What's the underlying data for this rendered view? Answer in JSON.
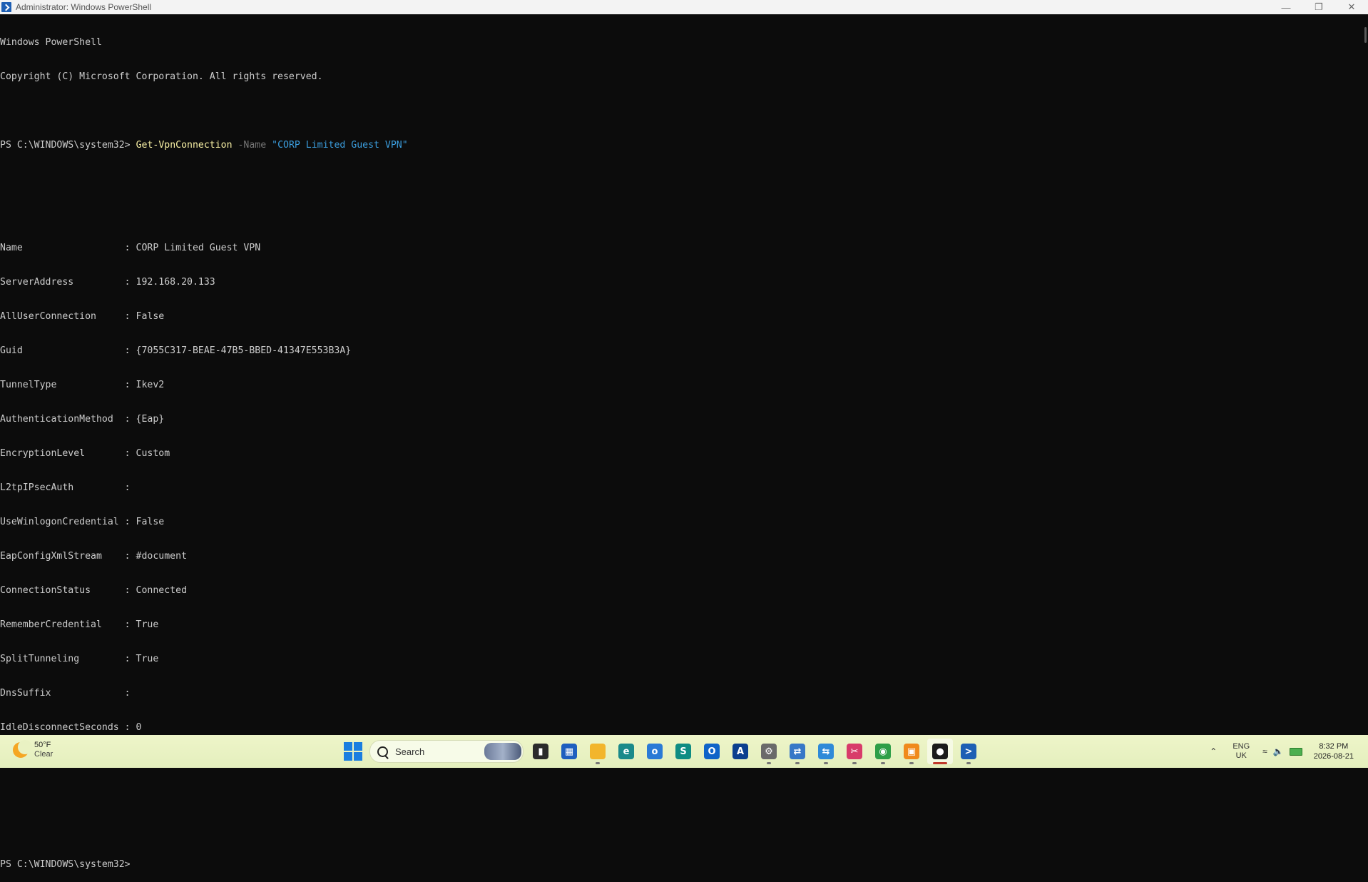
{
  "window": {
    "title": "Administrator: Windows PowerShell",
    "minimize_icon": "minimize-icon",
    "maximize_icon": "restore-icon",
    "close_icon": "close-icon"
  },
  "console": {
    "banner1": "Windows PowerShell",
    "banner2": "Copyright (C) Microsoft Corporation. All rights reserved.",
    "prompt": "PS C:\\WINDOWS\\system32> ",
    "command": "Get-VpnConnection",
    "param": " -Name ",
    "arg": "\"CORP Limited Guest VPN\"",
    "output": [
      "Name                  : CORP Limited Guest VPN",
      "ServerAddress         : 192.168.20.133",
      "AllUserConnection     : False",
      "Guid                  : {7055C317-BEAE-47B5-BBED-41347E553B3A}",
      "TunnelType            : Ikev2",
      "AuthenticationMethod  : {Eap}",
      "EncryptionLevel       : Custom",
      "L2tpIPsecAuth         :",
      "UseWinlogonCredential : False",
      "EapConfigXmlStream    : #document",
      "ConnectionStatus      : Connected",
      "RememberCredential    : True",
      "SplitTunneling        : True",
      "DnsSuffix             :",
      "IdleDisconnectSeconds : 0"
    ],
    "final_prompt": "PS C:\\WINDOWS\\system32>"
  },
  "taskbar": {
    "weather": {
      "temp": "50°F",
      "condition": "Clear",
      "icon": "moon-icon"
    },
    "search": {
      "label": "Search"
    },
    "apps": [
      {
        "name": "task-view",
        "icon": "task-view-icon",
        "color": "#2b2b2b",
        "glyph": "▮",
        "running": false
      },
      {
        "name": "microsoft-store",
        "icon": "store-icon",
        "color": "#1f5fbf",
        "glyph": "▦",
        "running": false
      },
      {
        "name": "file-explorer",
        "icon": "folder-icon",
        "color": "#f2b52c",
        "glyph": "",
        "running": true
      },
      {
        "name": "edge",
        "icon": "edge-icon",
        "color": "#1b8a8a",
        "glyph": "e",
        "running": false
      },
      {
        "name": "outlook-new",
        "icon": "outlook-new-icon",
        "color": "#2a7ad6",
        "glyph": "o",
        "running": false
      },
      {
        "name": "sharepoint",
        "icon": "sharepoint-icon",
        "color": "#0e8c83",
        "glyph": "S",
        "running": false
      },
      {
        "name": "outlook",
        "icon": "outlook-icon",
        "color": "#0f64c8",
        "glyph": "O",
        "running": false
      },
      {
        "name": "azure-data-studio",
        "icon": "a-icon",
        "color": "#0b3f8f",
        "glyph": "A",
        "running": false
      },
      {
        "name": "settings",
        "icon": "gear-icon",
        "color": "#6a6a6a",
        "glyph": "⚙",
        "running": true
      },
      {
        "name": "remote-desktop-1",
        "icon": "remote-desktop-icon",
        "color": "#3878c7",
        "glyph": "⇄",
        "running": true
      },
      {
        "name": "remote-desktop-2",
        "icon": "remote-desktop-connection-icon",
        "color": "#2f8ad8",
        "glyph": "⇆",
        "running": true
      },
      {
        "name": "snipping-tool",
        "icon": "snipping-tool-icon",
        "color": "#d83b6a",
        "glyph": "✂",
        "running": true
      },
      {
        "name": "chrome",
        "icon": "chrome-icon",
        "color": "#2e9e48",
        "glyph": "◉",
        "running": true
      },
      {
        "name": "remote-desktop-manager",
        "icon": "window-icon",
        "color": "#f08a1c",
        "glyph": "▣",
        "running": true
      },
      {
        "name": "github-desktop",
        "icon": "github-icon",
        "color": "#1b1b1b",
        "glyph": "●",
        "running": true,
        "active": true
      },
      {
        "name": "powershell",
        "icon": "powershell-icon",
        "color": "#1e5fb4",
        "glyph": ">",
        "running": true
      }
    ],
    "tray": {
      "chevron_icon": "chevron-up-icon",
      "lang_line1": "ENG",
      "lang_line2": "UK",
      "network_icon": "wifi-icon",
      "volume_icon": "speaker-icon",
      "battery_icon": "battery-icon",
      "time": "8:32 PM",
      "date": "2026-08-21"
    }
  }
}
